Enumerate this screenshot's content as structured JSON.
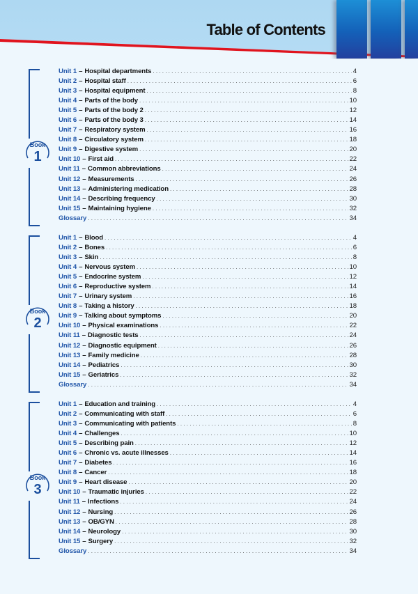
{
  "header": {
    "title": "Table of Contents",
    "colors": {
      "accent_blue": "#1b4f9e",
      "red_line": "#e0141e",
      "header_bg": "#aed8f2",
      "page_bg": "#eef7fd"
    }
  },
  "books": [
    {
      "badge_word": "Book",
      "badge_number": "1",
      "units": [
        {
          "label": "Unit 1",
          "title": "Hospital departments",
          "page": "4"
        },
        {
          "label": "Unit 2",
          "title": "Hospital staff",
          "page": "6"
        },
        {
          "label": "Unit 3",
          "title": "Hospital equipment",
          "page": "8"
        },
        {
          "label": "Unit 4",
          "title": "Parts of the body",
          "page": "10"
        },
        {
          "label": "Unit 5",
          "title": "Parts of the body 2",
          "page": "12"
        },
        {
          "label": "Unit 6",
          "title": "Parts of the body 3",
          "page": "14"
        },
        {
          "label": "Unit 7",
          "title": "Respiratory system",
          "page": "16"
        },
        {
          "label": "Unit 8",
          "title": "Circulatory system",
          "page": "18"
        },
        {
          "label": "Unit 9",
          "title": "Digestive system",
          "page": "20"
        },
        {
          "label": "Unit 10",
          "title": "First aid",
          "page": "22"
        },
        {
          "label": "Unit 11",
          "title": "Common abbreviations",
          "page": "24"
        },
        {
          "label": "Unit 12",
          "title": "Measurements",
          "page": "26"
        },
        {
          "label": "Unit 13",
          "title": "Administering medication",
          "page": "28"
        },
        {
          "label": "Unit 14",
          "title": "Describing frequency",
          "page": "30"
        },
        {
          "label": "Unit 15",
          "title": "Maintaining hygiene",
          "page": "32"
        }
      ],
      "glossary": {
        "label": "Glossary",
        "page": "34"
      }
    },
    {
      "badge_word": "Book",
      "badge_number": "2",
      "units": [
        {
          "label": "Unit 1",
          "title": "Blood",
          "page": "4"
        },
        {
          "label": "Unit 2",
          "title": "Bones",
          "page": "6"
        },
        {
          "label": "Unit 3",
          "title": "Skin",
          "page": "8"
        },
        {
          "label": "Unit 4",
          "title": "Nervous system",
          "page": "10"
        },
        {
          "label": "Unit 5",
          "title": "Endocrine system",
          "page": "12"
        },
        {
          "label": "Unit 6",
          "title": "Reproductive system",
          "page": "14"
        },
        {
          "label": "Unit 7",
          "title": "Urinary system",
          "page": "16"
        },
        {
          "label": "Unit 8",
          "title": "Taking a history",
          "page": "18"
        },
        {
          "label": "Unit 9",
          "title": "Talking about symptoms",
          "page": "20"
        },
        {
          "label": "Unit 10",
          "title": "Physical examinations",
          "page": "22"
        },
        {
          "label": "Unit 11",
          "title": "Diagnostic tests",
          "page": "24"
        },
        {
          "label": "Unit 12",
          "title": "Diagnostic equipment",
          "page": "26"
        },
        {
          "label": "Unit 13",
          "title": "Family medicine",
          "page": "28"
        },
        {
          "label": "Unit 14",
          "title": "Pediatrics",
          "page": "30"
        },
        {
          "label": "Unit 15",
          "title": "Geriatrics",
          "page": "32"
        }
      ],
      "glossary": {
        "label": "Glossary",
        "page": "34"
      }
    },
    {
      "badge_word": "Book",
      "badge_number": "3",
      "units": [
        {
          "label": "Unit 1",
          "title": "Education and training",
          "page": "4"
        },
        {
          "label": "Unit 2",
          "title": "Communicating with staff",
          "page": "6"
        },
        {
          "label": "Unit 3",
          "title": "Communicating with patients",
          "page": "8"
        },
        {
          "label": "Unit 4",
          "title": "Challenges",
          "page": "10"
        },
        {
          "label": "Unit 5",
          "title": "Describing pain",
          "page": "12"
        },
        {
          "label": "Unit 6",
          "title": "Chronic vs. acute illnesses",
          "page": "14"
        },
        {
          "label": "Unit 7",
          "title": "Diabetes",
          "page": "16"
        },
        {
          "label": "Unit 8",
          "title": "Cancer",
          "page": "18"
        },
        {
          "label": "Unit 9",
          "title": "Heart disease",
          "page": "20"
        },
        {
          "label": "Unit 10",
          "title": "Traumatic injuries",
          "page": "22"
        },
        {
          "label": "Unit 11",
          "title": "Infections",
          "page": "24"
        },
        {
          "label": "Unit 12",
          "title": "Nursing",
          "page": "26"
        },
        {
          "label": "Unit 13",
          "title": "OB/GYN",
          "page": "28"
        },
        {
          "label": "Unit 14",
          "title": "Neurology",
          "page": "30"
        },
        {
          "label": "Unit 15",
          "title": "Surgery",
          "page": "32"
        }
      ],
      "glossary": {
        "label": "Glossary",
        "page": "34"
      }
    }
  ],
  "dash": "–"
}
